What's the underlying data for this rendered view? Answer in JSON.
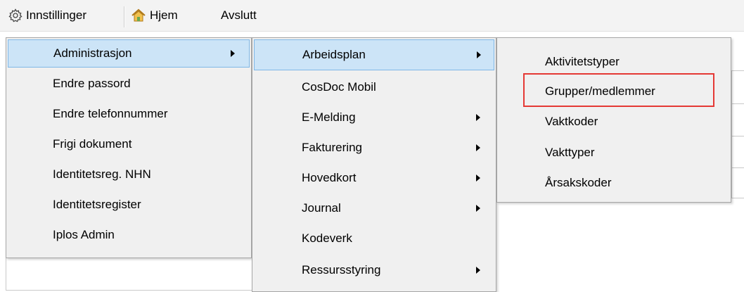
{
  "menubar": {
    "items": [
      {
        "label": "Innstillinger",
        "icon": "gear-icon"
      },
      {
        "label": "Hjem",
        "icon": "home-icon"
      },
      {
        "label": "Avslutt"
      }
    ]
  },
  "menu_level1": {
    "items": [
      {
        "label": "Administrasjon",
        "submenu": true,
        "highlighted": true
      },
      {
        "label": "Endre passord"
      },
      {
        "label": "Endre telefonnummer"
      },
      {
        "label": "Frigi dokument"
      },
      {
        "label": "Identitetsreg. NHN"
      },
      {
        "label": "Identitetsregister"
      },
      {
        "label": "Iplos Admin"
      }
    ]
  },
  "menu_level2": {
    "items": [
      {
        "label": "Arbeidsplan",
        "submenu": true,
        "highlighted": true
      },
      {
        "label": "CosDoc Mobil"
      },
      {
        "label": "E-Melding",
        "submenu": true
      },
      {
        "label": "Fakturering",
        "submenu": true
      },
      {
        "label": "Hovedkort",
        "submenu": true
      },
      {
        "label": "Journal",
        "submenu": true
      },
      {
        "label": "Kodeverk"
      },
      {
        "label": "Ressursstyring",
        "submenu": true
      }
    ]
  },
  "menu_level3": {
    "items": [
      {
        "label": "Aktivitetstyper"
      },
      {
        "label": "Grupper/medlemmer",
        "annotated": true
      },
      {
        "label": "Vaktkoder"
      },
      {
        "label": "Vakttyper"
      },
      {
        "label": "Årsakskoder"
      }
    ]
  },
  "colors": {
    "highlight_bg": "#cce4f7",
    "highlight_border": "#7fb7e6",
    "annotation": "#e53935",
    "menu_bg": "#f0f0f0"
  }
}
